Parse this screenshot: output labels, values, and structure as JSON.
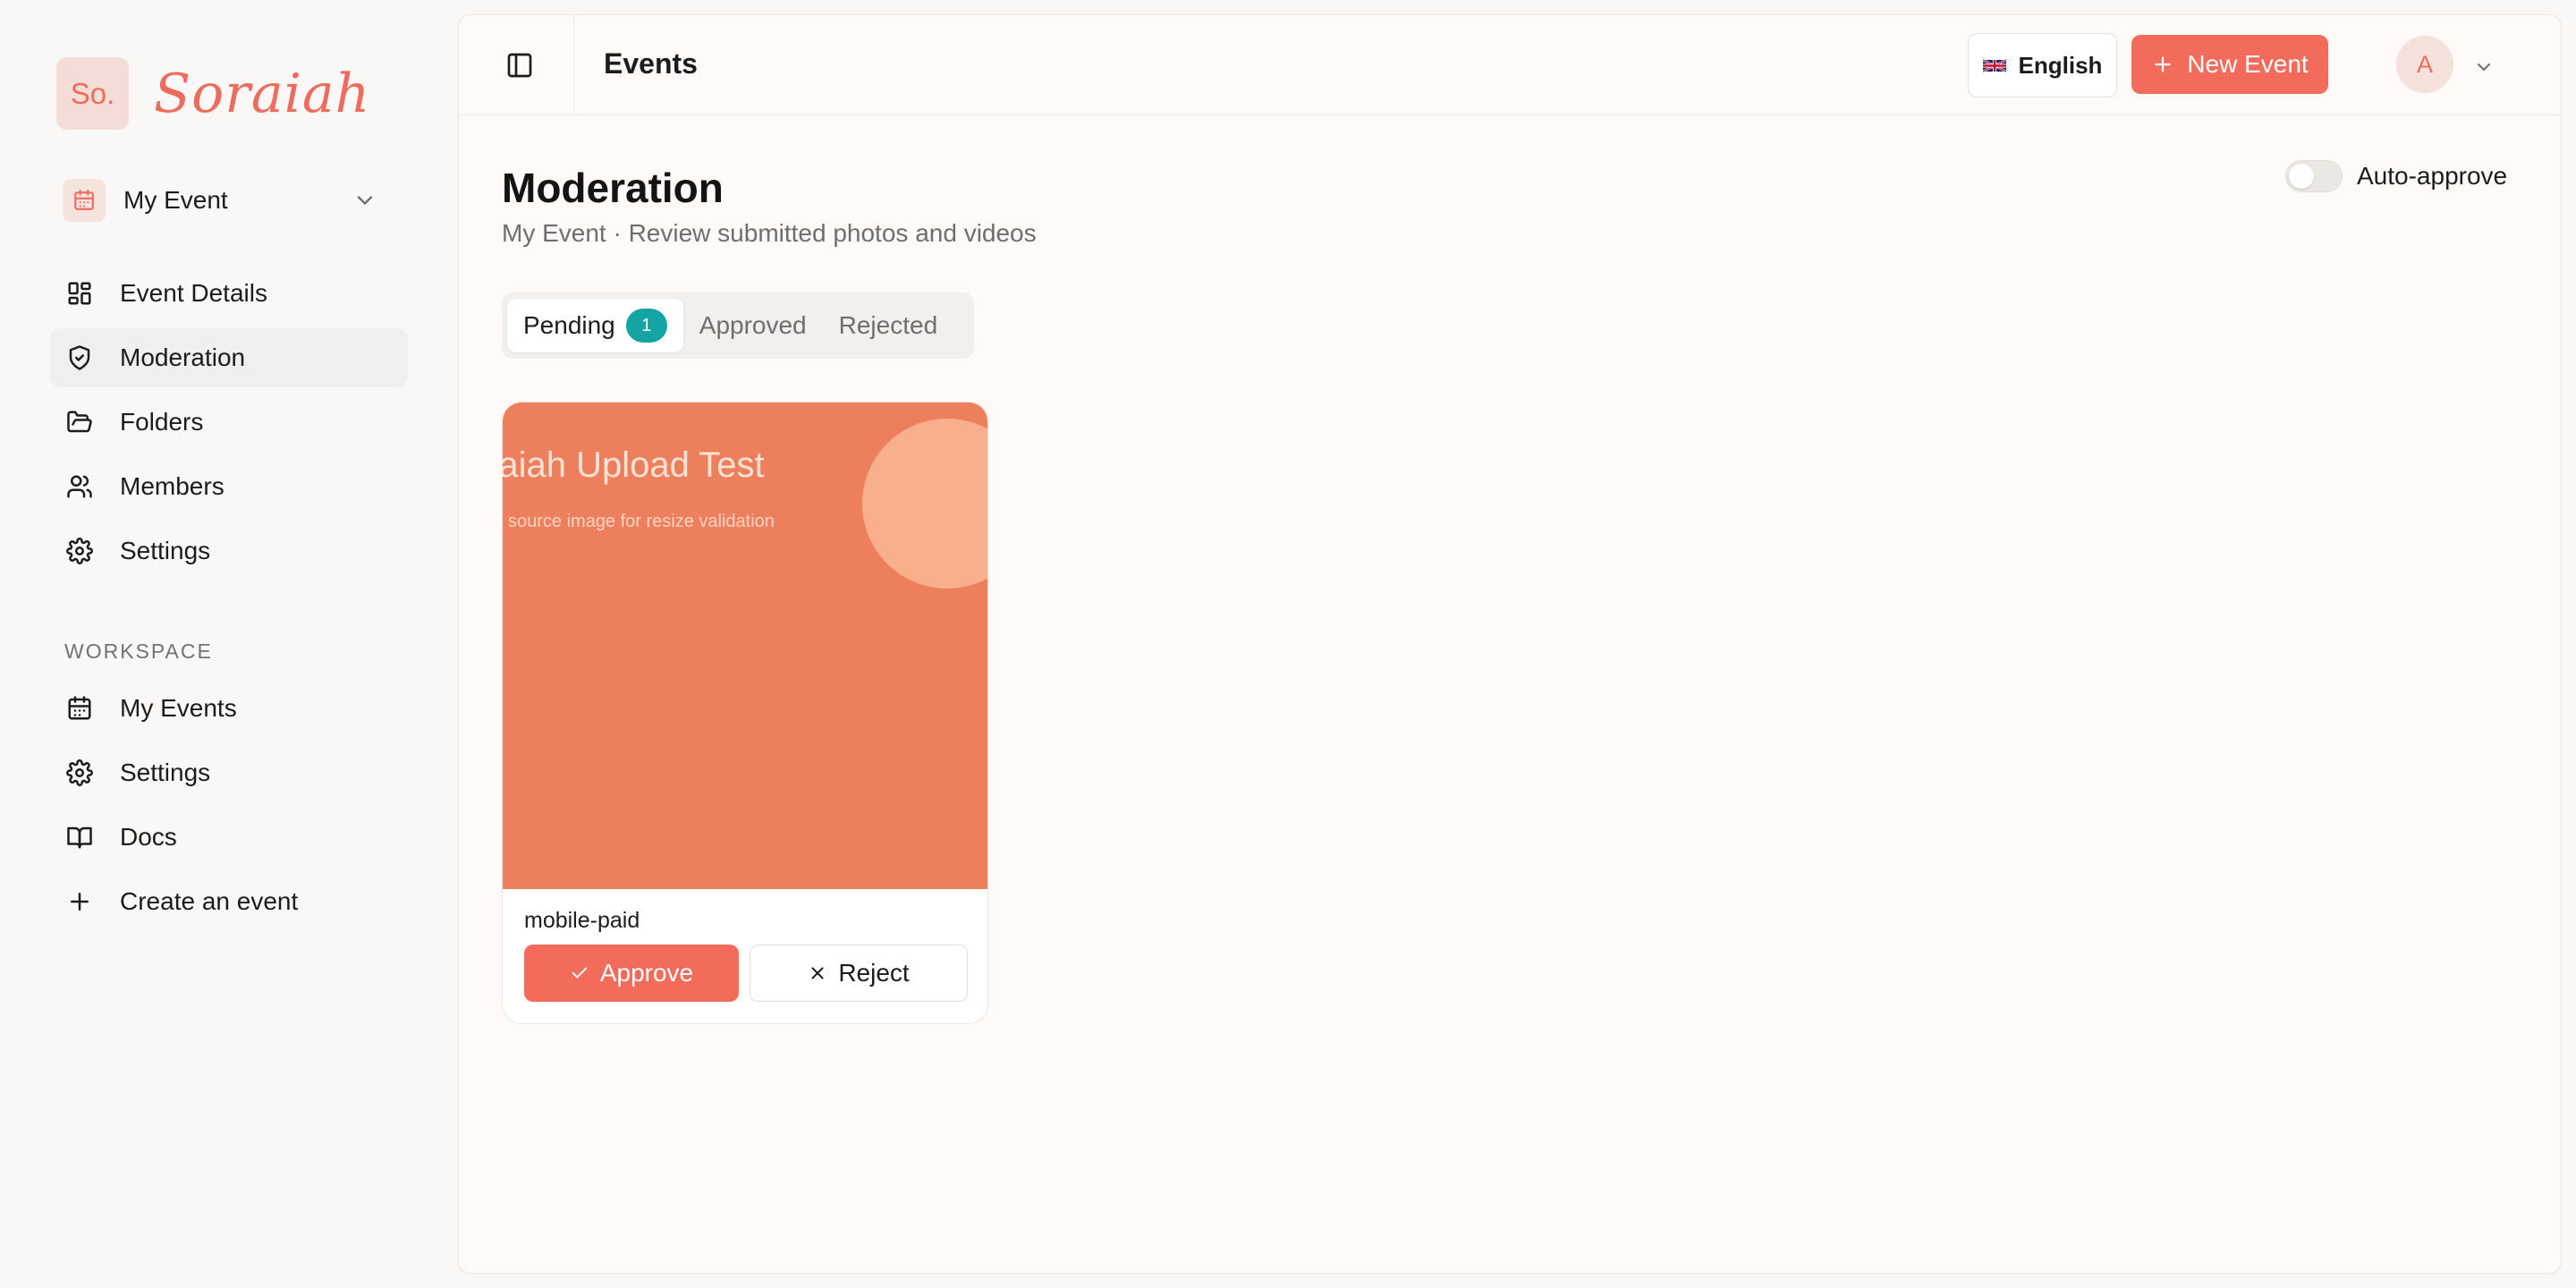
{
  "brand": {
    "mark": "So.",
    "name": "Soraiah"
  },
  "event_switcher": {
    "label": "My Event"
  },
  "sidebar": {
    "items": [
      {
        "label": "Event Details",
        "icon": "dashboard-icon"
      },
      {
        "label": "Moderation",
        "icon": "shield-check-icon",
        "active": true
      },
      {
        "label": "Folders",
        "icon": "folder-open-icon"
      },
      {
        "label": "Members",
        "icon": "users-icon"
      },
      {
        "label": "Settings",
        "icon": "gear-icon"
      }
    ],
    "workspace_title": "WORKSPACE",
    "workspace_items": [
      {
        "label": "My Events",
        "icon": "calendar-icon"
      },
      {
        "label": "Settings",
        "icon": "gear-icon"
      },
      {
        "label": "Docs",
        "icon": "book-open-icon"
      },
      {
        "label": "Create an event",
        "icon": "plus-icon"
      }
    ]
  },
  "topbar": {
    "title": "Events",
    "language": "English",
    "new_event": "New Event",
    "avatar_initial": "A"
  },
  "page": {
    "title": "Moderation",
    "subtitle": "My Event · Review submitted photos and videos",
    "auto_approve_label": "Auto-approve",
    "auto_approve_on": false
  },
  "tabs": [
    {
      "label": "Pending",
      "badge": "1",
      "active": true
    },
    {
      "label": "Approved"
    },
    {
      "label": "Rejected"
    }
  ],
  "cards": [
    {
      "thumb_title": "raiah Upload Test",
      "thumb_subtitle": "source image for resize validation",
      "name": "mobile-paid",
      "approve_label": "Approve",
      "reject_label": "Reject"
    }
  ],
  "colors": {
    "accent": "#f26b5b",
    "badge": "#14a4a4",
    "thumb_bg": "#ee7f5c"
  }
}
